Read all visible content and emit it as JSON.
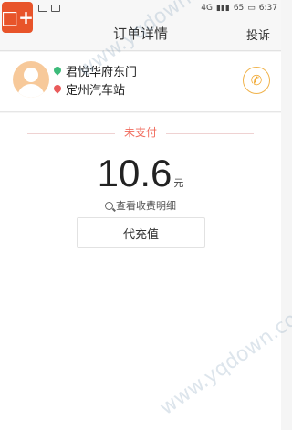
{
  "status_bar": {
    "time": "6:37",
    "battery": "65",
    "network": "4G"
  },
  "app_badge": "□+",
  "header": {
    "title": "订单详情",
    "right_action": "投诉"
  },
  "trip": {
    "origin": "君悦华府东门",
    "destination": "定州汽车站"
  },
  "order": {
    "status": "未支付",
    "amount": "10.6",
    "unit": "元",
    "fee_detail_link": "查看收费明细",
    "recharge_button": "代充值"
  },
  "watermark": "www.yqdown.com",
  "colors": {
    "accent_orange": "#f0a52a",
    "status_red": "#f06a5b",
    "origin_green": "#3dbb7a",
    "destination_red": "#e95b5b"
  },
  "icons": {
    "phone": "phone-icon",
    "search": "search-icon",
    "avatar": "user-avatar-icon"
  }
}
